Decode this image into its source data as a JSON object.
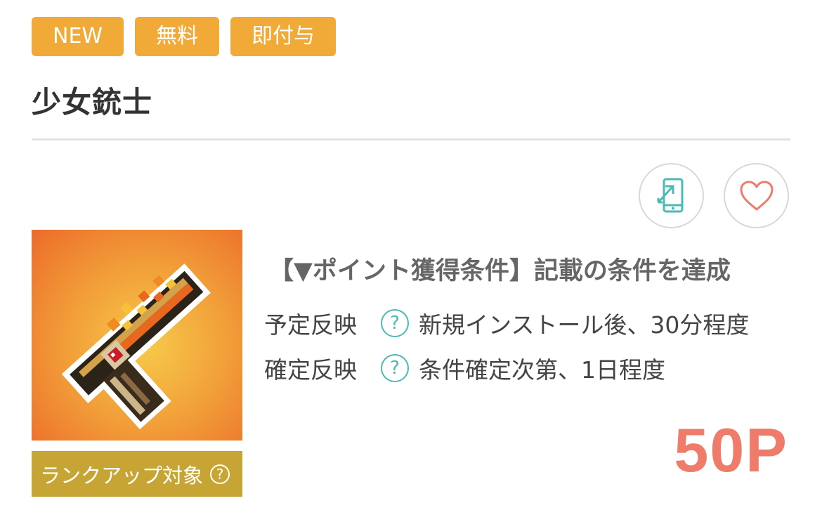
{
  "tags": [
    "NEW",
    "無料",
    "即付与"
  ],
  "app": {
    "title": "少女銃士",
    "icon_name": "pixel-gun-icon"
  },
  "actions": {
    "device_icon": "phone-transfer-icon",
    "favorite_icon": "heart-icon"
  },
  "rank_badge": {
    "label": "ランクアップ対象",
    "help": "?"
  },
  "condition": "【▼ポイント獲得条件】記載の条件を達成",
  "schedule": [
    {
      "label": "予定反映",
      "help": "?",
      "value": "新規インストール後、30分程度"
    },
    {
      "label": "確定反映",
      "help": "?",
      "value": "条件確定次第、1日程度"
    }
  ],
  "points": "50P",
  "colors": {
    "tag": "#f1aa38",
    "rank": "#c6a535",
    "accent": "#4cb9b3",
    "points": "#ef7b6a"
  }
}
